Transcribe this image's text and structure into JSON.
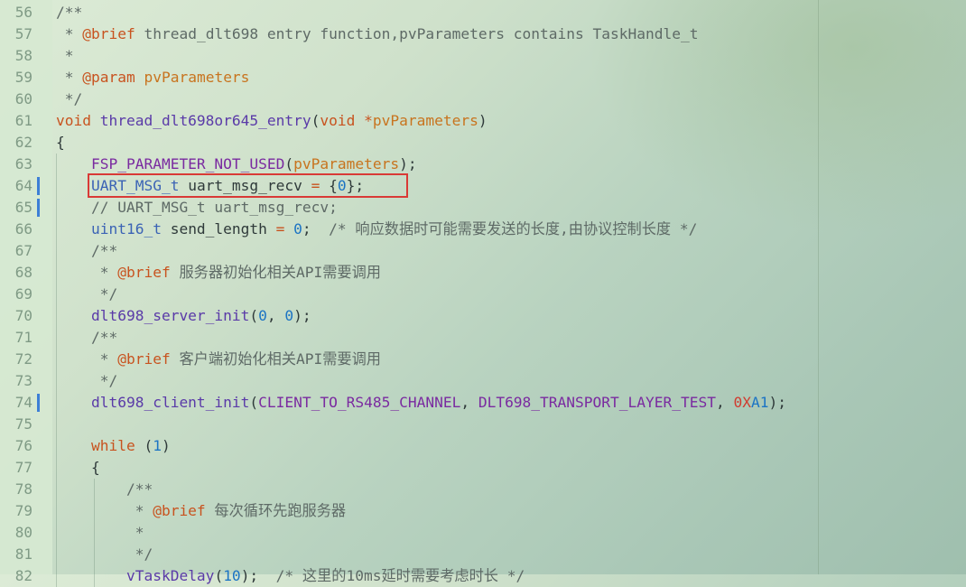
{
  "editor": {
    "lines": [
      {
        "n": "56",
        "segs": [
          [
            "c-cm",
            "/**"
          ]
        ]
      },
      {
        "n": "57",
        "segs": [
          [
            "c-cm",
            " * "
          ],
          [
            "c-tag",
            "@brief"
          ],
          [
            "c-cm",
            " thread_dlt698 entry function,pvParameters contains TaskHandle_t"
          ]
        ]
      },
      {
        "n": "58",
        "segs": [
          [
            "c-cm",
            " *"
          ]
        ]
      },
      {
        "n": "59",
        "segs": [
          [
            "c-cm",
            " * "
          ],
          [
            "c-tag",
            "@param"
          ],
          [
            "c-par",
            " pvParameters"
          ]
        ]
      },
      {
        "n": "60",
        "segs": [
          [
            "c-cm",
            " */"
          ]
        ]
      },
      {
        "n": "61",
        "segs": [
          [
            "c-kw",
            "void"
          ],
          [
            "",
            ""
          ],
          [
            "c-fn",
            " thread_dlt698or645_entry"
          ],
          [
            "",
            "("
          ],
          [
            "c-kw",
            "void"
          ],
          [
            "",
            " "
          ],
          [
            "c-op",
            "*"
          ],
          [
            "c-par",
            "pvParameters"
          ],
          [
            "",
            ")"
          ]
        ]
      },
      {
        "n": "62",
        "segs": [
          [
            "",
            "{"
          ]
        ]
      },
      {
        "n": "63",
        "segs": [
          [
            "",
            "    "
          ],
          [
            "c-mac",
            "FSP_PARAMETER_NOT_USED"
          ],
          [
            "",
            "("
          ],
          [
            "c-par",
            "pvParameters"
          ],
          [
            "",
            ");"
          ]
        ]
      },
      {
        "n": "64",
        "mod": true,
        "segs": [
          [
            "",
            "    "
          ],
          [
            "c-ty",
            "UART_MSG_t"
          ],
          [
            "",
            " uart_msg_recv "
          ],
          [
            "c-op",
            "="
          ],
          [
            "",
            " {"
          ],
          [
            "c-num",
            "0"
          ],
          [
            "",
            "};"
          ]
        ]
      },
      {
        "n": "65",
        "mod": true,
        "segs": [
          [
            "c-cm",
            "    // UART_MSG_t uart_msg_recv;"
          ]
        ]
      },
      {
        "n": "66",
        "segs": [
          [
            "",
            "    "
          ],
          [
            "c-ty",
            "uint16_t"
          ],
          [
            "",
            " send_length "
          ],
          [
            "c-op",
            "="
          ],
          [
            "",
            " "
          ],
          [
            "c-num",
            "0"
          ],
          [
            "",
            ";  "
          ],
          [
            "c-cm",
            "/* 响应数据时可能需要发送的长度,由协议控制长度 */"
          ]
        ]
      },
      {
        "n": "67",
        "segs": [
          [
            "c-cm",
            "    /**"
          ]
        ]
      },
      {
        "n": "68",
        "segs": [
          [
            "c-cm",
            "     * "
          ],
          [
            "c-tag",
            "@brief"
          ],
          [
            "c-cm",
            " 服务器初始化相关API需要调用"
          ]
        ]
      },
      {
        "n": "69",
        "segs": [
          [
            "c-cm",
            "     */"
          ]
        ]
      },
      {
        "n": "70",
        "segs": [
          [
            "",
            "    "
          ],
          [
            "c-fn",
            "dlt698_server_init"
          ],
          [
            "",
            "("
          ],
          [
            "c-num",
            "0"
          ],
          [
            "",
            ", "
          ],
          [
            "c-num",
            "0"
          ],
          [
            "",
            ");"
          ]
        ]
      },
      {
        "n": "71",
        "segs": [
          [
            "c-cm",
            "    /**"
          ]
        ]
      },
      {
        "n": "72",
        "segs": [
          [
            "c-cm",
            "     * "
          ],
          [
            "c-tag",
            "@brief"
          ],
          [
            "c-cm",
            " 客户端初始化相关API需要调用"
          ]
        ]
      },
      {
        "n": "73",
        "segs": [
          [
            "c-cm",
            "     */"
          ]
        ]
      },
      {
        "n": "74",
        "mod": true,
        "segs": [
          [
            "",
            "    "
          ],
          [
            "c-fn",
            "dlt698_client_init"
          ],
          [
            "",
            "("
          ],
          [
            "c-mac",
            "CLIENT_TO_RS485_CHANNEL"
          ],
          [
            "",
            ", "
          ],
          [
            "c-mac",
            "DLT698_TRANSPORT_LAYER_TEST"
          ],
          [
            "",
            ", "
          ],
          [
            "c-hex",
            "0X"
          ],
          [
            "c-num",
            "A1"
          ],
          [
            "",
            ");"
          ]
        ]
      },
      {
        "n": "75",
        "segs": []
      },
      {
        "n": "76",
        "segs": [
          [
            "",
            "    "
          ],
          [
            "c-kw",
            "while"
          ],
          [
            "",
            " ("
          ],
          [
            "c-num",
            "1"
          ],
          [
            "",
            ")"
          ]
        ]
      },
      {
        "n": "77",
        "segs": [
          [
            "",
            "    {"
          ]
        ]
      },
      {
        "n": "78",
        "segs": [
          [
            "c-cm",
            "        /**"
          ]
        ]
      },
      {
        "n": "79",
        "segs": [
          [
            "c-cm",
            "         * "
          ],
          [
            "c-tag",
            "@brief"
          ],
          [
            "c-cm",
            " 每次循环先跑服务器"
          ]
        ]
      },
      {
        "n": "80",
        "segs": [
          [
            "c-cm",
            "         *"
          ]
        ]
      },
      {
        "n": "81",
        "segs": [
          [
            "c-cm",
            "         */"
          ]
        ]
      },
      {
        "n": "82",
        "segs": [
          [
            "",
            "        "
          ],
          [
            "c-fn",
            "vTaskDelay"
          ],
          [
            "",
            "("
          ],
          [
            "c-num",
            "10"
          ],
          [
            "",
            ");  "
          ],
          [
            "c-cm",
            "/* 这里的10ms延时需要考虑时长 */"
          ]
        ]
      }
    ]
  },
  "colors": {
    "accent_box": "#d93a36",
    "modified_marker": "#3d7fd6"
  }
}
